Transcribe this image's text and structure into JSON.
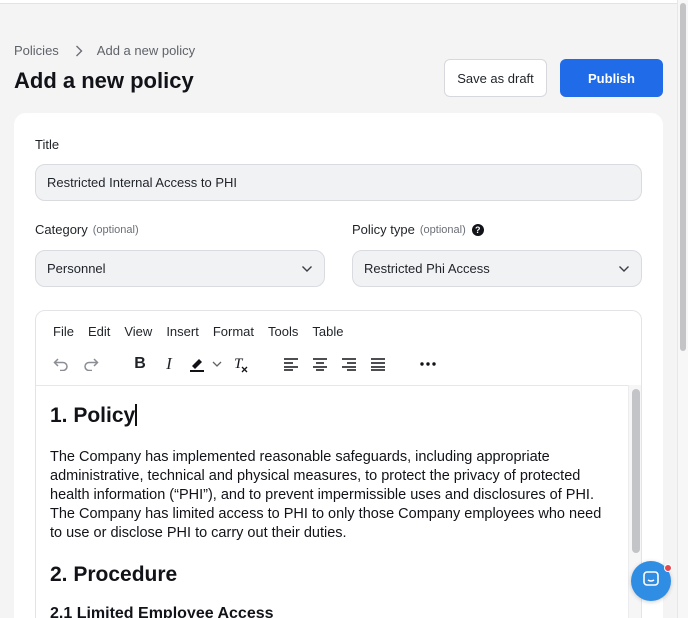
{
  "breadcrumb": {
    "parent": "Policies",
    "current": "Add a new policy"
  },
  "page": {
    "title": "Add a new policy"
  },
  "actions": {
    "draft_label": "Save as draft",
    "publish_label": "Publish"
  },
  "form": {
    "title_label": "Title",
    "title_value": "Restricted Internal Access to PHI",
    "category_label": "Category",
    "category_optional": "(optional)",
    "category_value": "Personnel",
    "policy_type_label": "Policy type",
    "policy_type_optional": "(optional)",
    "policy_type_value": "Restricted Phi Access"
  },
  "editor": {
    "menu": [
      "File",
      "Edit",
      "View",
      "Insert",
      "Format",
      "Tools",
      "Table"
    ],
    "toolbar_icons": [
      "undo-icon",
      "redo-icon",
      "bold-icon",
      "italic-icon",
      "highlight-icon",
      "clear-format-icon",
      "align-left-icon",
      "align-center-icon",
      "align-right-icon",
      "justify-icon",
      "more-icon"
    ],
    "content": {
      "h1": "1. Policy",
      "paragraph": "The Company has implemented reasonable safeguards, including appropriate administrative, technical and physical measures, to protect the privacy of protected health information (“PHI”), and to prevent impermissible uses and disclosures of PHI. The Company has limited access to PHI to only those Company employees who need to use or disclose PHI to carry out their duties.",
      "h2": "2. Procedure",
      "h3": "2.1 Limited Employee Access"
    }
  },
  "colors": {
    "primary": "#1f6be8",
    "chat": "#2f8de4",
    "notification": "#e5484d"
  }
}
